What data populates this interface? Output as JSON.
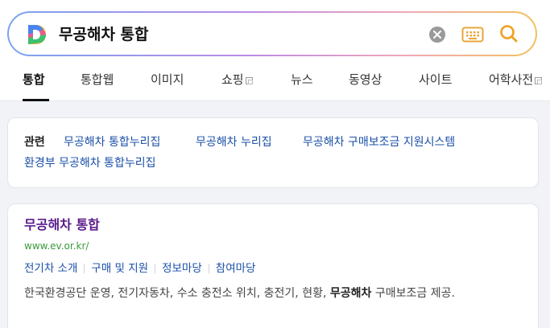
{
  "search": {
    "query": "무공해차 통합",
    "logo": "daum-d-logo",
    "icons": [
      "clear-icon",
      "keyboard-icon",
      "search-icon"
    ]
  },
  "tabs": [
    {
      "label": "통합",
      "active": true
    },
    {
      "label": "통합웹"
    },
    {
      "label": "이미지"
    },
    {
      "label": "쇼핑",
      "external": true
    },
    {
      "label": "뉴스"
    },
    {
      "label": "동영상"
    },
    {
      "label": "사이트"
    },
    {
      "label": "어학사전",
      "external": true
    }
  ],
  "related": {
    "label": "관련",
    "links": [
      "무공해차 통합누리집",
      "무공해차 누리집",
      "무공해차 구매보조금 지원시스템",
      "환경부 무공해차 통합누리집"
    ]
  },
  "result": {
    "title": "무공해차 통합",
    "url": "www.ev.or.kr/",
    "sublinks": [
      "전기차 소개",
      "구매 및 지원",
      "정보마당",
      "참여마당"
    ],
    "snippet_before": "한국환경공단 운영, 전기자동차, 수소 충전소 위치, 충전기, 현황, ",
    "snippet_bold": "무공해차",
    "snippet_after": " 구매보조금 제공."
  },
  "colors": {
    "link": "#1a4fa8",
    "visited_title": "#5a1a8a",
    "url_green": "#3a9a3a",
    "search_accent": "#f0a020"
  }
}
